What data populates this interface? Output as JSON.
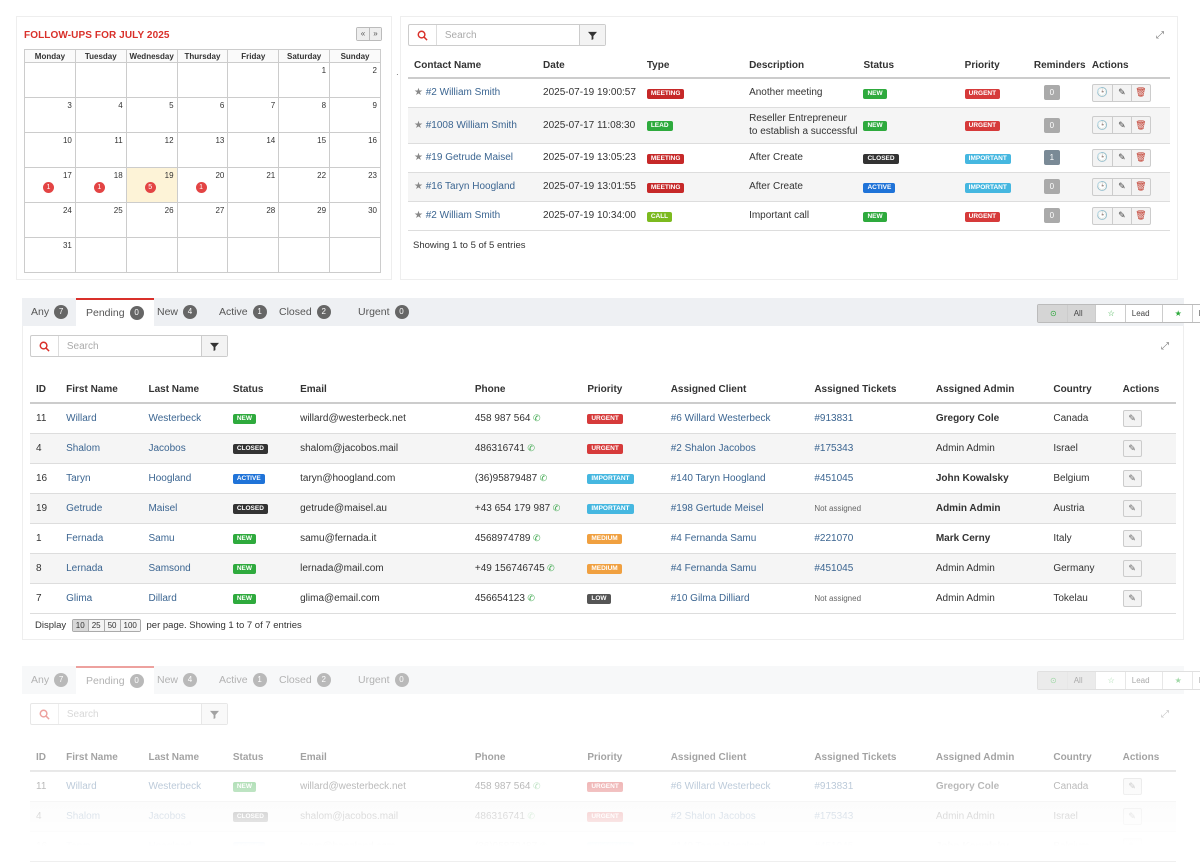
{
  "calendar": {
    "title": "FOLLOW-UPS FOR JULY 2025",
    "nav_prev": "«",
    "nav_next": "»",
    "weekdays": [
      "Monday",
      "Tuesday",
      "Wednesday",
      "Thursday",
      "Friday",
      "Saturday",
      "Sunday"
    ],
    "weeks": [
      [
        {
          "d": ""
        },
        {
          "d": ""
        },
        {
          "d": ""
        },
        {
          "d": ""
        },
        {
          "d": ""
        },
        {
          "d": "1"
        },
        {
          "d": "2"
        }
      ],
      [
        {
          "d": "3"
        },
        {
          "d": "4"
        },
        {
          "d": "5"
        },
        {
          "d": "6"
        },
        {
          "d": "7"
        },
        {
          "d": "8"
        },
        {
          "d": "9"
        }
      ],
      [
        {
          "d": "10"
        },
        {
          "d": "11"
        },
        {
          "d": "12"
        },
        {
          "d": "13"
        },
        {
          "d": "14"
        },
        {
          "d": "15"
        },
        {
          "d": "16"
        }
      ],
      [
        {
          "d": "17",
          "c": "1"
        },
        {
          "d": "18",
          "c": "1"
        },
        {
          "d": "19",
          "c": "5",
          "today": true
        },
        {
          "d": "20",
          "c": "1"
        },
        {
          "d": "21"
        },
        {
          "d": "22"
        },
        {
          "d": "23"
        }
      ],
      [
        {
          "d": "24"
        },
        {
          "d": "25"
        },
        {
          "d": "26"
        },
        {
          "d": "27"
        },
        {
          "d": "28"
        },
        {
          "d": "29"
        },
        {
          "d": "30"
        }
      ],
      [
        {
          "d": "31"
        },
        {
          "d": ""
        },
        {
          "d": ""
        },
        {
          "d": ""
        },
        {
          "d": ""
        },
        {
          "d": ""
        },
        {
          "d": ""
        }
      ]
    ]
  },
  "followups": {
    "search_placeholder": "Search",
    "columns": [
      "Contact Name",
      "Date",
      "Type",
      "Description",
      "Status",
      "Priority",
      "Reminders",
      "Actions"
    ],
    "rows": [
      {
        "contact": "#2 William Smith",
        "date": "2025-07-19 19:00:57",
        "type": "MEETING",
        "type_cls": "b-meeting",
        "desc": "Another meeting",
        "desc2": "",
        "status": "NEW",
        "status_cls": "b-new",
        "priority": "URGENT",
        "priority_cls": "b-urgent",
        "reminders": "0",
        "dark": false
      },
      {
        "contact": "#1008 William Smith",
        "date": "2025-07-17 11:08:30",
        "type": "LEAD",
        "type_cls": "b-lead",
        "desc": "Reseller Entrepreneur",
        "desc2": "to establish a successful",
        "status": "NEW",
        "status_cls": "b-new",
        "priority": "URGENT",
        "priority_cls": "b-urgent",
        "reminders": "0",
        "dark": false
      },
      {
        "contact": "#19 Getrude Maisel",
        "date": "2025-07-19 13:05:23",
        "type": "MEETING",
        "type_cls": "b-meeting",
        "desc": "After Create",
        "desc2": "",
        "status": "CLOSED",
        "status_cls": "b-closed",
        "priority": "IMPORTANT",
        "priority_cls": "b-important",
        "reminders": "1",
        "dark": true
      },
      {
        "contact": "#16 Taryn Hoogland",
        "date": "2025-07-19 13:01:55",
        "type": "MEETING",
        "type_cls": "b-meeting",
        "desc": "After Create",
        "desc2": "",
        "status": "ACTIVE",
        "status_cls": "b-active",
        "priority": "IMPORTANT",
        "priority_cls": "b-important",
        "reminders": "0",
        "dark": false
      },
      {
        "contact": "#2 William Smith",
        "date": "2025-07-19 10:34:00",
        "type": "CALL",
        "type_cls": "b-call",
        "desc": "Important call",
        "desc2": "",
        "status": "NEW",
        "status_cls": "b-new",
        "priority": "URGENT",
        "priority_cls": "b-urgent",
        "reminders": "0",
        "dark": false
      }
    ],
    "info": "Showing 1 to 5 of 5 entries"
  },
  "tabs": [
    {
      "label": "Any",
      "count": "7"
    },
    {
      "label": "Pending",
      "count": "0",
      "active": true
    },
    {
      "label": "New",
      "count": "4"
    },
    {
      "label": "Active",
      "count": "1"
    },
    {
      "label": "Closed",
      "count": "2"
    },
    {
      "label": "Urgent",
      "count": "0"
    }
  ],
  "segment": [
    {
      "label": "All",
      "icon": "⊙",
      "on": true
    },
    {
      "label": "Lead",
      "icon": "☆"
    },
    {
      "label": "Potential",
      "icon": "★"
    }
  ],
  "contacts": {
    "search_placeholder": "Search",
    "columns": [
      "ID",
      "First Name",
      "Last Name",
      "Status",
      "Email",
      "Phone",
      "Priority",
      "Assigned Client",
      "Assigned Tickets",
      "Assigned Admin",
      "Country",
      "Actions"
    ],
    "rows": [
      {
        "id": "11",
        "first": "Willard",
        "last": "Westerbeck",
        "status": "NEW",
        "status_cls": "b-new",
        "email": "willard@westerbeck.net",
        "phone": "458 987 564",
        "priority": "URGENT",
        "priority_cls": "b-urgent",
        "client": "#6 Willard Westerbeck",
        "ticket": "#913831",
        "admin": "Gregory Cole",
        "admin_bold": true,
        "country": "Canada"
      },
      {
        "id": "4",
        "first": "Shalom",
        "last": "Jacobos",
        "status": "CLOSED",
        "status_cls": "b-closed",
        "email": "shalom@jacobos.mail",
        "phone": "486316741",
        "priority": "URGENT",
        "priority_cls": "b-urgent",
        "client": "#2 Shalon Jacobos",
        "ticket": "#175343",
        "admin": "Admin Admin",
        "admin_bold": false,
        "country": "Israel"
      },
      {
        "id": "16",
        "first": "Taryn",
        "last": "Hoogland",
        "status": "ACTIVE",
        "status_cls": "b-active",
        "email": "taryn@hoogland.com",
        "phone": "(36)95879487",
        "priority": "IMPORTANT",
        "priority_cls": "b-important",
        "client": "#140 Taryn Hoogland",
        "ticket": "#451045",
        "admin": "John Kowalsky",
        "admin_bold": true,
        "country": "Belgium"
      },
      {
        "id": "19",
        "first": "Getrude",
        "last": "Maisel",
        "status": "CLOSED",
        "status_cls": "b-closed",
        "email": "getrude@maisel.au",
        "phone": "+43 654 179 987",
        "priority": "IMPORTANT",
        "priority_cls": "b-important",
        "client": "#198 Gertude Meisel",
        "ticket": "Not assigned",
        "admin": "Admin Admin",
        "admin_bold": true,
        "country": "Austria"
      },
      {
        "id": "1",
        "first": "Fernada",
        "last": "Samu",
        "status": "NEW",
        "status_cls": "b-new",
        "email": "samu@fernada.it",
        "phone": "4568974789",
        "priority": "MEDIUM",
        "priority_cls": "b-medium",
        "client": "#4 Fernanda Samu",
        "ticket": "#221070",
        "admin": "Mark Cerny",
        "admin_bold": true,
        "country": "Italy"
      },
      {
        "id": "8",
        "first": "Lernada",
        "last": "Samsond",
        "status": "NEW",
        "status_cls": "b-new",
        "email": "lernada@mail.com",
        "phone": "+49 156746745",
        "priority": "MEDIUM",
        "priority_cls": "b-medium",
        "client": "#4 Fernanda Samu",
        "ticket": "#451045",
        "admin": "Admin Admin",
        "admin_bold": false,
        "country": "Germany"
      },
      {
        "id": "7",
        "first": "Glima",
        "last": "Dillard",
        "status": "NEW",
        "status_cls": "b-new",
        "email": "glima@email.com",
        "phone": "456654123",
        "priority": "LOW",
        "priority_cls": "b-low",
        "client": "#10 Gilma Dilliard",
        "ticket": "Not assigned",
        "admin": "Admin Admin",
        "admin_bold": false,
        "country": "Tokelau"
      }
    ],
    "display_label": "Display",
    "page_sizes": [
      "10",
      "25",
      "50",
      "100"
    ],
    "info": "per page. Showing 1 to 7 of 7 entries"
  }
}
